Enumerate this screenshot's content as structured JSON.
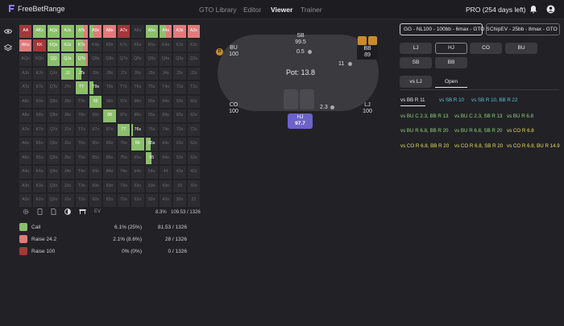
{
  "app": {
    "brand": "FreeBetRange",
    "subscription": "PRO (254 days left)"
  },
  "nav": [
    "GTO Library",
    "Editor",
    "Viewer",
    "Trainer"
  ],
  "active_nav": "Viewer",
  "colors": {
    "call": "#8bbf6c",
    "raise_small": "#e07b7b",
    "raise_big": "#a33838",
    "hero": "#6b63c9",
    "accent_yellow": "#e6de5a",
    "accent_blue": "#59c3e0",
    "accent_green": "#8fd47b"
  },
  "range_grid": {
    "rows": [
      [
        "AA",
        "AKs",
        "AQs",
        "AJs",
        "ATs",
        "A9s",
        "A8s",
        "A7s",
        "A6s",
        "A5s",
        "A4s",
        "A3s",
        "A2s"
      ],
      [
        "AKo",
        "KK",
        "KQs",
        "KJs",
        "KTs",
        "K9s",
        "K8s",
        "K7s",
        "K6s",
        "K5s",
        "K4s",
        "K3s",
        "K2s"
      ],
      [
        "AQo",
        "KQo",
        "QQ",
        "QJs",
        "QTs",
        "Q9s",
        "Q8s",
        "Q7s",
        "Q6s",
        "Q5s",
        "Q4s",
        "Q3s",
        "Q2s"
      ],
      [
        "AJo",
        "KJo",
        "QJo",
        "JJ",
        "JTs",
        "J9s",
        "J8s",
        "J7s",
        "J6s",
        "J5s",
        "J4s",
        "J3s",
        "J2s"
      ],
      [
        "ATo",
        "KTo",
        "QTo",
        "JTo",
        "TT",
        "T9s",
        "T8s",
        "T7s",
        "T6s",
        "T5s",
        "T4s",
        "T3s",
        "T2s"
      ],
      [
        "A9o",
        "K9o",
        "Q9o",
        "J9o",
        "T9o",
        "99",
        "98s",
        "97s",
        "96s",
        "95s",
        "94s",
        "93s",
        "92s"
      ],
      [
        "A8o",
        "K8o",
        "Q8o",
        "J8o",
        "T8o",
        "98o",
        "88",
        "87s",
        "86s",
        "85s",
        "84s",
        "83s",
        "82s"
      ],
      [
        "A7o",
        "K7o",
        "Q7o",
        "J7o",
        "T7o",
        "97o",
        "87o",
        "77",
        "76s",
        "75s",
        "74s",
        "73s",
        "72s"
      ],
      [
        "A6o",
        "K6o",
        "Q6o",
        "J6o",
        "T6o",
        "96o",
        "86o",
        "76o",
        "66",
        "65s",
        "64s",
        "63s",
        "62s"
      ],
      [
        "A5o",
        "K5o",
        "Q5o",
        "J5o",
        "T5o",
        "95o",
        "85o",
        "75o",
        "65o",
        "55",
        "54s",
        "53s",
        "52s"
      ],
      [
        "A4o",
        "K4o",
        "Q4o",
        "J4o",
        "T4o",
        "94o",
        "84o",
        "74o",
        "64o",
        "54o",
        "44",
        "43s",
        "42s"
      ],
      [
        "A3o",
        "K3o",
        "Q3o",
        "J3o",
        "T3o",
        "93o",
        "83o",
        "73o",
        "63o",
        "53o",
        "43o",
        "33",
        "32s"
      ],
      [
        "A2o",
        "K2o",
        "Q2o",
        "J2o",
        "T2o",
        "92o",
        "82o",
        "72o",
        "62o",
        "52o",
        "42o",
        "32o",
        "22"
      ]
    ],
    "mixes": {
      "AA": [
        0,
        0,
        1
      ],
      "AKs": [
        1,
        0,
        0
      ],
      "AQs": [
        1,
        0,
        0
      ],
      "AJs": [
        1,
        0,
        0
      ],
      "ATs": [
        0.7,
        0.3,
        0
      ],
      "A9s": [
        0.3,
        0.7,
        0
      ],
      "A8s": [
        0,
        1,
        0
      ],
      "A7s": [
        0,
        0,
        1
      ],
      "A5s": [
        1,
        0,
        0
      ],
      "A4s": [
        0.5,
        0.5,
        0
      ],
      "A3s": [
        0,
        1,
        0
      ],
      "A2s": [
        0,
        1,
        0
      ],
      "AKo": [
        0,
        1,
        0
      ],
      "KK": [
        0,
        0,
        1
      ],
      "KQs": [
        1,
        0,
        0
      ],
      "KJs": [
        1,
        0,
        0
      ],
      "KTs": [
        0.6,
        0.4,
        0
      ],
      "QQ": [
        1,
        0,
        0
      ],
      "QJs": [
        1,
        0,
        0
      ],
      "QTs": [
        0.8,
        0.2,
        0
      ],
      "JJ": [
        1,
        0,
        0
      ],
      "JTs": [
        0.5,
        0,
        0
      ],
      "TT": [
        1,
        0,
        0
      ],
      "T9s": [
        0.3,
        0,
        0
      ],
      "99": [
        1,
        0,
        0
      ],
      "88": [
        1,
        0,
        0
      ],
      "77": [
        1,
        0,
        0
      ],
      "76s": [
        0.15,
        0,
        0
      ],
      "66": [
        1,
        0,
        0
      ],
      "65s": [
        0.4,
        0,
        0
      ],
      "55": [
        0.5,
        0,
        0
      ]
    },
    "highlight": [
      "JTs",
      "T9s",
      "99",
      "88",
      "77",
      "76s",
      "66",
      "65s",
      "55",
      "QJs",
      "QTs",
      "JJ",
      "TT",
      "KK",
      "QQ",
      "AA",
      "AKs",
      "AQs",
      "AJs",
      "ATs",
      "A9s",
      "A8s",
      "A7s",
      "AKo",
      "KQs",
      "KJs",
      "KTs",
      "A5s",
      "A4s",
      "A3s",
      "A2s"
    ]
  },
  "toolbar": {
    "icons": [
      "gear-icon",
      "mobile-icon",
      "document-icon",
      "contrast-icon",
      "table-icon"
    ],
    "ev_label": "EV",
    "overall_pct": "8.3%",
    "overall_combos": "109.53 / 1326"
  },
  "legend": [
    {
      "name": "Call",
      "pct": "6.1% (25%)",
      "combos": "81.53 / 1326",
      "color": "#8bbf6c"
    },
    {
      "name": "Raise 24.2",
      "pct": "2.1% (8.6%)",
      "combos": "28 / 1326",
      "color": "#e07b7b"
    },
    {
      "name": "Raise 100",
      "pct": "0% (0%)",
      "combos": "0 / 1326",
      "color": "#a33838"
    }
  ],
  "table": {
    "pot": "Pot: 13.8",
    "dealer": "D",
    "seats": {
      "bu": {
        "name": "BU",
        "stack": "100"
      },
      "sb": {
        "name": "SB",
        "stack": "99.5",
        "bet": "0.5"
      },
      "bb": {
        "name": "BB",
        "stack": "89",
        "bet": "11"
      },
      "co": {
        "name": "CO",
        "stack": "100"
      },
      "hj": {
        "name": "HJ",
        "stack": "97.7",
        "bet": "2.3"
      },
      "lj": {
        "name": "LJ",
        "stack": "100"
      }
    }
  },
  "right": {
    "dropdowns": [
      "GG - NL100 - 100bb - 6max - GTO S",
      "ChipEV - 25bb - 8max - GTO"
    ],
    "positions": [
      "LJ",
      "HJ",
      "CO",
      "BU",
      "SB",
      "BB"
    ],
    "selected_position": "HJ",
    "tabs": [
      "vs LJ",
      "Open"
    ],
    "active_tab": "Open",
    "actions": [
      {
        "text": "vs BB R 11",
        "color": "#e6e6ea",
        "active": true
      },
      {
        "text": "vs SB R 10",
        "color": "#59c3e0"
      },
      {
        "text": "vs SB R 10, BB R 22",
        "color": "#59c3e0"
      },
      {
        "text": "vs BU C 2.3, BB R 13",
        "color": "#8fd47b"
      },
      {
        "text": "vs BU C 2.3, SB R 13",
        "color": "#8fd47b"
      },
      {
        "text": "vs BU R 6.8",
        "color": "#8fd47b"
      },
      {
        "text": "vs BU R 6.8, BB R 20",
        "color": "#8fd47b"
      },
      {
        "text": "vs BU R 6.8, SB R 20",
        "color": "#8fd47b"
      },
      {
        "text": "vs CO R 6.8",
        "color": "#e6de5a"
      },
      {
        "text": "vs CO R 6.8, BB R 20",
        "color": "#e6de5a"
      },
      {
        "text": "vs CO R 6.8, SB R 20",
        "color": "#e6de5a"
      },
      {
        "text": "vs CO R 6.8, BU R 14.9",
        "color": "#e6de5a"
      }
    ]
  }
}
